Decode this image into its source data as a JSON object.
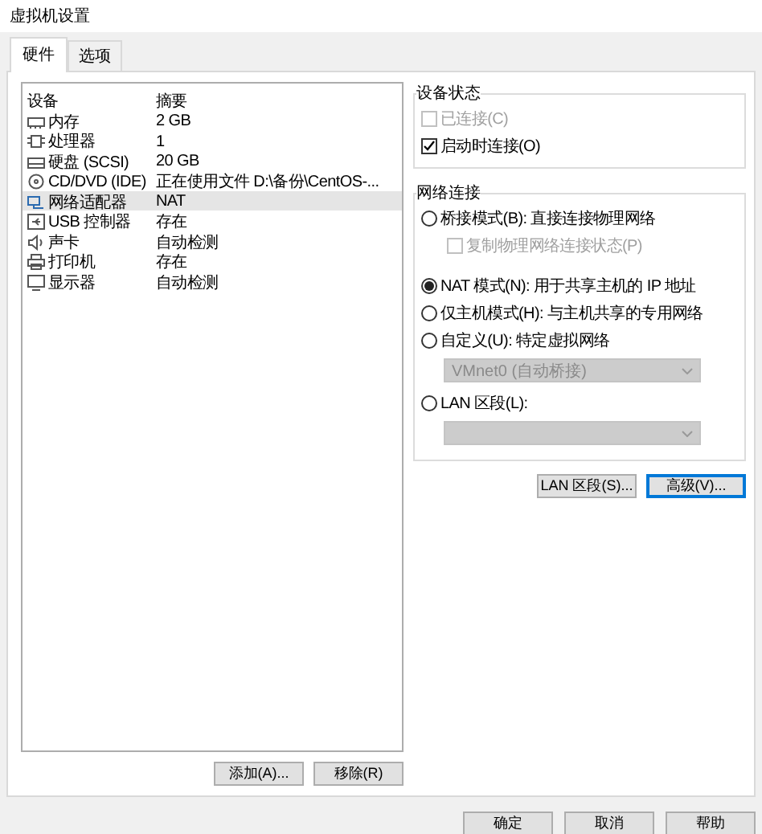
{
  "window": {
    "title": "虚拟机设置"
  },
  "tabs": [
    {
      "label": "硬件",
      "selected": true
    },
    {
      "label": "选项",
      "selected": false
    }
  ],
  "device_table": {
    "columns": [
      "设备",
      "摘要"
    ],
    "rows": [
      {
        "kind": "memory",
        "device": "内存",
        "summary": "2 GB",
        "selected": false
      },
      {
        "kind": "cpu",
        "device": "处理器",
        "summary": "1",
        "selected": false
      },
      {
        "kind": "disk",
        "device": "硬盘 (SCSI)",
        "summary": "20 GB",
        "selected": false
      },
      {
        "kind": "cdrom",
        "device": "CD/DVD (IDE)",
        "summary": "正在使用文件 D:\\备份\\CentOS-...",
        "selected": false
      },
      {
        "kind": "network",
        "device": "网络适配器",
        "summary": "NAT",
        "selected": true
      },
      {
        "kind": "usb",
        "device": "USB 控制器",
        "summary": "存在",
        "selected": false
      },
      {
        "kind": "sound",
        "device": "声卡",
        "summary": "自动检测",
        "selected": false
      },
      {
        "kind": "printer",
        "device": "打印机",
        "summary": "存在",
        "selected": false
      },
      {
        "kind": "display",
        "device": "显示器",
        "summary": "自动检测",
        "selected": false
      }
    ]
  },
  "list_buttons": [
    "添加(A)...",
    "移除(R)"
  ],
  "device_status": {
    "title": "设备状态",
    "items": [
      {
        "label": "已连接(C)",
        "checked": false,
        "disabled": true
      },
      {
        "label": "启动时连接(O)",
        "checked": true,
        "disabled": false
      }
    ]
  },
  "network_connection": {
    "title": "网络连接",
    "options": [
      {
        "kind": "radio",
        "label": "桥接模式(B): 直接连接物理网络",
        "selected": false
      },
      {
        "kind": "checkbox",
        "label": "复制物理网络连接状态(P)",
        "checked": false,
        "disabled": true
      },
      {
        "kind": "radio",
        "label": "NAT 模式(N): 用于共享主机的 IP 地址",
        "selected": true
      },
      {
        "kind": "radio",
        "label": "仅主机模式(H): 与主机共享的专用网络",
        "selected": false
      },
      {
        "kind": "radio",
        "label": "自定义(U): 特定虚拟网络",
        "selected": false
      },
      {
        "kind": "select",
        "value": "VMnet0 (自动桥接)",
        "disabled": true
      },
      {
        "kind": "radio",
        "label": "LAN 区段(L):",
        "selected": false
      },
      {
        "kind": "select",
        "disabled": true
      }
    ]
  },
  "panel_buttons": [
    {
      "label": "LAN 区段(S)...",
      "focused": false
    },
    {
      "label": "高级(V)...",
      "focused": true
    }
  ],
  "dialog_buttons": [
    "确定",
    "取消",
    "帮助"
  ]
}
